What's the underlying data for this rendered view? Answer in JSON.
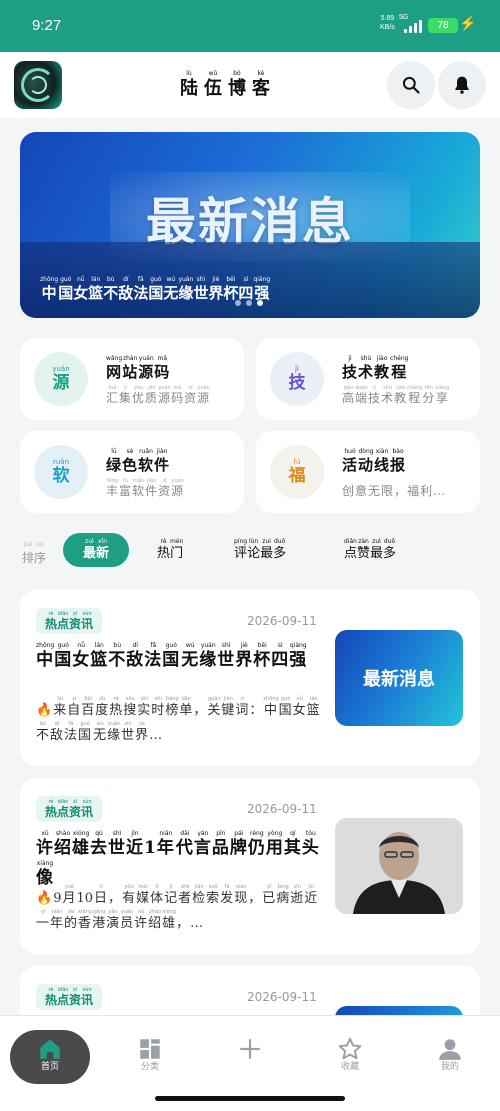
{
  "status_bar": {
    "time": "9:27",
    "net_speed_value": "5.89",
    "net_speed_unit": "KB/s",
    "network": "5G",
    "battery": "78"
  },
  "header": {
    "title": [
      {
        "py": "lù",
        "hz": "陆"
      },
      {
        "py": "wǔ",
        "hz": "伍"
      },
      {
        "py": "bó",
        "hz": "博"
      },
      {
        "py": "kè",
        "hz": "客"
      }
    ],
    "logo_icon": "dragon-logo",
    "search_icon": "search-icon",
    "bell_icon": "bell-icon"
  },
  "banner": {
    "headline": "最新消息",
    "caption": [
      {
        "py": "zhōng",
        "hz": "中"
      },
      {
        "py": "guó",
        "hz": "国"
      },
      {
        "py": "nǚ",
        "hz": "女"
      },
      {
        "py": "lán",
        "hz": "篮"
      },
      {
        "py": "bù",
        "hz": "不"
      },
      {
        "py": "dí",
        "hz": "敌"
      },
      {
        "py": "fǎ",
        "hz": "法"
      },
      {
        "py": "guó",
        "hz": "国"
      },
      {
        "py": "",
        "hz": " "
      },
      {
        "py": "wú",
        "hz": "无"
      },
      {
        "py": "yuán",
        "hz": "缘"
      },
      {
        "py": "shì",
        "hz": "世"
      },
      {
        "py": "jiè",
        "hz": "界"
      },
      {
        "py": "bēi",
        "hz": "杯"
      },
      {
        "py": "sì",
        "hz": "四"
      },
      {
        "py": "qiáng",
        "hz": "强"
      }
    ],
    "slide_count": 3,
    "active_slide": 2
  },
  "quick_cards": [
    {
      "icon": {
        "py": "yuán",
        "hz": "源",
        "color": "#1f9e86",
        "bg": "#e3f4f0"
      },
      "title": [
        {
          "py": "wǎng",
          "hz": "网"
        },
        {
          "py": "zhàn",
          "hz": "站"
        },
        {
          "py": "yuán",
          "hz": "源"
        },
        {
          "py": "mǎ",
          "hz": "码"
        }
      ],
      "desc": [
        {
          "py": "huì",
          "hz": "汇"
        },
        {
          "py": "jí",
          "hz": "集"
        },
        {
          "py": "yōu",
          "hz": "优"
        },
        {
          "py": "zhì",
          "hz": "质"
        },
        {
          "py": "yuán",
          "hz": "源"
        },
        {
          "py": "mǎ",
          "hz": "码"
        },
        {
          "py": "zī",
          "hz": "资"
        },
        {
          "py": "yuán",
          "hz": "源"
        }
      ]
    },
    {
      "icon": {
        "py": "jì",
        "hz": "技",
        "color": "#6a4fd6",
        "bg": "#e9f1f6"
      },
      "title": [
        {
          "py": "jì",
          "hz": "技"
        },
        {
          "py": "shù",
          "hz": "术"
        },
        {
          "py": "jiào",
          "hz": "教"
        },
        {
          "py": "chéng",
          "hz": "程"
        }
      ],
      "desc": [
        {
          "py": "gāo",
          "hz": "高"
        },
        {
          "py": "duān",
          "hz": "端"
        },
        {
          "py": "jì",
          "hz": "技"
        },
        {
          "py": "shù",
          "hz": "术"
        },
        {
          "py": "jiào",
          "hz": "教"
        },
        {
          "py": "chéng",
          "hz": "程"
        },
        {
          "py": "fēn",
          "hz": "分"
        },
        {
          "py": "xiǎng",
          "hz": "享"
        }
      ]
    },
    {
      "icon": {
        "py": "ruǎn",
        "hz": "软",
        "color": "#1aa0c8",
        "bg": "#e3f1f6"
      },
      "title": [
        {
          "py": "lǜ",
          "hz": "绿"
        },
        {
          "py": "sè",
          "hz": "色"
        },
        {
          "py": "ruǎn",
          "hz": "软"
        },
        {
          "py": "jiàn",
          "hz": "件"
        }
      ],
      "desc": [
        {
          "py": "fēng",
          "hz": "丰"
        },
        {
          "py": "fù",
          "hz": "富"
        },
        {
          "py": "ruǎn",
          "hz": "软"
        },
        {
          "py": "jiàn",
          "hz": "件"
        },
        {
          "py": "zī",
          "hz": "资"
        },
        {
          "py": "yuán",
          "hz": "源"
        }
      ]
    },
    {
      "icon": {
        "py": "fú",
        "hz": "福",
        "color": "#e0891a",
        "bg": "#f1f3ec"
      },
      "title": [
        {
          "py": "huó",
          "hz": "活"
        },
        {
          "py": "dòng",
          "hz": "动"
        },
        {
          "py": "xiàn",
          "hz": "线"
        },
        {
          "py": "bào",
          "hz": "报"
        }
      ],
      "desc": [
        {
          "py": "",
          "hz": "创"
        },
        {
          "py": "",
          "hz": "意"
        },
        {
          "py": "",
          "hz": "无"
        },
        {
          "py": "",
          "hz": "限"
        },
        {
          "py": "",
          "hz": "，"
        },
        {
          "py": "",
          "hz": "福"
        },
        {
          "py": "",
          "hz": "利"
        },
        {
          "py": "",
          "hz": "…"
        }
      ]
    }
  ],
  "sort": {
    "label": [
      {
        "py": "pái",
        "hz": "排"
      },
      {
        "py": "xù",
        "hz": "序"
      }
    ],
    "tabs": [
      {
        "chars": [
          {
            "py": "zuì",
            "hz": "最"
          },
          {
            "py": "xīn",
            "hz": "新"
          }
        ],
        "active": true
      },
      {
        "chars": [
          {
            "py": "rè",
            "hz": "热"
          },
          {
            "py": "mén",
            "hz": "门"
          }
        ],
        "active": false
      },
      {
        "chars": [
          {
            "py": "píng",
            "hz": "评"
          },
          {
            "py": "lùn",
            "hz": "论"
          },
          {
            "py": "zuì",
            "hz": "最"
          },
          {
            "py": "duō",
            "hz": "多"
          }
        ],
        "active": false
      },
      {
        "chars": [
          {
            "py": "diǎn",
            "hz": "点"
          },
          {
            "py": "zàn",
            "hz": "赞"
          },
          {
            "py": "zuì",
            "hz": "最"
          },
          {
            "py": "duō",
            "hz": "多"
          }
        ],
        "active": false
      }
    ]
  },
  "articles": [
    {
      "category": [
        {
          "py": "rè",
          "hz": "热"
        },
        {
          "py": "diǎn",
          "hz": "点"
        },
        {
          "py": "zī",
          "hz": "资"
        },
        {
          "py": "xùn",
          "hz": "讯"
        }
      ],
      "date": "2026-09-11",
      "title": [
        {
          "py": "zhōng",
          "hz": "中"
        },
        {
          "py": "guó",
          "hz": "国"
        },
        {
          "py": "nǚ",
          "hz": "女"
        },
        {
          "py": "lán",
          "hz": "篮"
        },
        {
          "py": "bù",
          "hz": "不"
        },
        {
          "py": "dí",
          "hz": "敌"
        },
        {
          "py": "fǎ",
          "hz": "法"
        },
        {
          "py": "guó",
          "hz": "国"
        },
        {
          "py": "",
          "hz": " "
        },
        {
          "py": "wú",
          "hz": "无"
        },
        {
          "py": "yuán",
          "hz": "缘"
        },
        {
          "py": "shì",
          "hz": "世"
        },
        {
          "py": "jiè",
          "hz": "界"
        },
        {
          "py": "bēi",
          "hz": "杯"
        },
        {
          "py": "sì",
          "hz": "四"
        },
        {
          "py": "qiáng",
          "hz": "强"
        }
      ],
      "summary": [
        {
          "py": "",
          "hz": "🔥"
        },
        {
          "py": "lái",
          "hz": "来"
        },
        {
          "py": "zì",
          "hz": "自"
        },
        {
          "py": "bǎi",
          "hz": "百"
        },
        {
          "py": "dù",
          "hz": "度"
        },
        {
          "py": "rè",
          "hz": "热"
        },
        {
          "py": "sōu",
          "hz": "搜"
        },
        {
          "py": "shí",
          "hz": "实"
        },
        {
          "py": "shí",
          "hz": "时"
        },
        {
          "py": "bǎng",
          "hz": "榜"
        },
        {
          "py": "dān",
          "hz": "单"
        },
        {
          "py": "",
          "hz": "，"
        },
        {
          "py": "guān",
          "hz": "关"
        },
        {
          "py": "jiàn",
          "hz": "键"
        },
        {
          "py": "cí",
          "hz": "词"
        },
        {
          "py": "",
          "hz": "："
        },
        {
          "py": "zhōng",
          "hz": "中"
        },
        {
          "py": "guó",
          "hz": "国"
        },
        {
          "py": "nǚ",
          "hz": "女"
        },
        {
          "py": "lán",
          "hz": "篮"
        },
        {
          "py": "bù",
          "hz": "不"
        },
        {
          "py": "dí",
          "hz": "敌"
        },
        {
          "py": "fǎ",
          "hz": "法"
        },
        {
          "py": "guó",
          "hz": "国"
        },
        {
          "py": "",
          "hz": " "
        },
        {
          "py": "wú",
          "hz": "无"
        },
        {
          "py": "yuán",
          "hz": "缘"
        },
        {
          "py": "shì",
          "hz": "世"
        },
        {
          "py": "jiè",
          "hz": "界"
        },
        {
          "py": "",
          "hz": "…"
        }
      ],
      "thumb_text": "最新消息",
      "thumb_kind": "news"
    },
    {
      "category": [
        {
          "py": "rè",
          "hz": "热"
        },
        {
          "py": "diǎn",
          "hz": "点"
        },
        {
          "py": "zī",
          "hz": "资"
        },
        {
          "py": "xùn",
          "hz": "讯"
        }
      ],
      "date": "2026-09-11",
      "title": [
        {
          "py": "xǔ",
          "hz": "许"
        },
        {
          "py": "shào",
          "hz": "绍"
        },
        {
          "py": "xióng",
          "hz": "雄"
        },
        {
          "py": "qù",
          "hz": "去"
        },
        {
          "py": "shì",
          "hz": "世"
        },
        {
          "py": "jìn",
          "hz": "近"
        },
        {
          "py": "",
          "hz": "1"
        },
        {
          "py": "nián",
          "hz": "年"
        },
        {
          "py": "",
          "hz": " "
        },
        {
          "py": "dài",
          "hz": "代"
        },
        {
          "py": "yán",
          "hz": "言"
        },
        {
          "py": "pǐn",
          "hz": "品"
        },
        {
          "py": "pái",
          "hz": "牌"
        },
        {
          "py": "réng",
          "hz": "仍"
        },
        {
          "py": "yòng",
          "hz": "用"
        },
        {
          "py": "qí",
          "hz": "其"
        },
        {
          "py": "tóu",
          "hz": "头"
        },
        {
          "py": "xiàng",
          "hz": "像"
        }
      ],
      "summary": [
        {
          "py": "",
          "hz": "🔥"
        },
        {
          "py": "",
          "hz": "9"
        },
        {
          "py": "yuè",
          "hz": "月"
        },
        {
          "py": "",
          "hz": "10"
        },
        {
          "py": "rì",
          "hz": "日"
        },
        {
          "py": "",
          "hz": "，"
        },
        {
          "py": "yǒu",
          "hz": "有"
        },
        {
          "py": "méi",
          "hz": "媒"
        },
        {
          "py": "tǐ",
          "hz": "体"
        },
        {
          "py": "jì",
          "hz": "记"
        },
        {
          "py": "zhě",
          "hz": "者"
        },
        {
          "py": "jiǎn",
          "hz": "检"
        },
        {
          "py": "suǒ",
          "hz": "索"
        },
        {
          "py": "fā",
          "hz": "发"
        },
        {
          "py": "xiàn",
          "hz": "现"
        },
        {
          "py": "",
          "hz": "，"
        },
        {
          "py": "yǐ",
          "hz": "已"
        },
        {
          "py": "bìng",
          "hz": "病"
        },
        {
          "py": "shì",
          "hz": "逝"
        },
        {
          "py": "jìn",
          "hz": "近"
        },
        {
          "py": "yì",
          "hz": "一"
        },
        {
          "py": "nián",
          "hz": "年"
        },
        {
          "py": "de",
          "hz": "的"
        },
        {
          "py": "xiāng",
          "hz": "香"
        },
        {
          "py": "gǎng",
          "hz": "港"
        },
        {
          "py": "yǎn",
          "hz": "演"
        },
        {
          "py": "yuán",
          "hz": "员"
        },
        {
          "py": "xǔ",
          "hz": "许"
        },
        {
          "py": "shào",
          "hz": "绍"
        },
        {
          "py": "xióng",
          "hz": "雄"
        },
        {
          "py": "",
          "hz": "，"
        },
        {
          "py": "",
          "hz": "…"
        }
      ],
      "thumb_text": "",
      "thumb_kind": "photo"
    },
    {
      "category": [
        {
          "py": "rè",
          "hz": "热"
        },
        {
          "py": "diǎn",
          "hz": "点"
        },
        {
          "py": "zī",
          "hz": "资"
        },
        {
          "py": "xùn",
          "hz": "讯"
        }
      ],
      "date": "2026-09-11",
      "title": [],
      "summary": [],
      "thumb_text": "",
      "thumb_kind": "news"
    }
  ],
  "bottom_nav": [
    {
      "label": "首页",
      "icon": "home-icon",
      "active": true
    },
    {
      "label": "分类",
      "icon": "grid-icon",
      "active": false
    },
    {
      "label": "",
      "icon": "plus-icon",
      "active": false
    },
    {
      "label": "收藏",
      "icon": "star-icon",
      "active": false
    },
    {
      "label": "我的",
      "icon": "user-icon",
      "active": false
    }
  ],
  "colors": {
    "accent": "#1f9e86",
    "banner_start": "#1446b8",
    "banner_end": "#36d1c9"
  }
}
